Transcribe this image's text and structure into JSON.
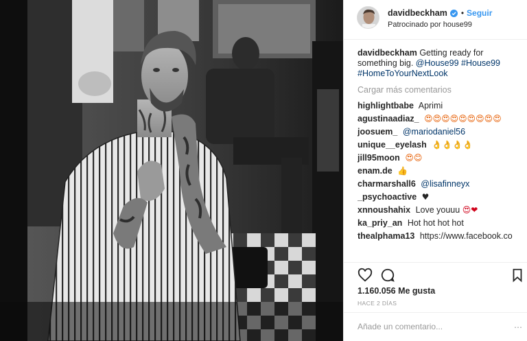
{
  "colors": {
    "link": "#003569",
    "follow": "#3897f0",
    "muted": "#999999",
    "text": "#262626",
    "heart": "#d0021b"
  },
  "header": {
    "username": "davidbeckham",
    "follow_label": "Seguir",
    "separator": "•",
    "sponsored": "Patrocinado por house99",
    "verified_icon": "verified-badge-icon"
  },
  "caption": {
    "user": "davidbeckham",
    "text": "Getting ready for something big.",
    "mentions": [
      "@House99",
      "#House99",
      "#HomeToYourNextLook"
    ]
  },
  "load_more": "Cargar más comentarios",
  "comments": [
    {
      "user": "highlightbabe",
      "text": "Aprimi"
    },
    {
      "user": "agustinaadiaz_",
      "text": "😍😍😍😍😍😍😍😍😍"
    },
    {
      "user": "joosuem_",
      "text": "@mariodaniel56"
    },
    {
      "user": "unique__eyelash",
      "text": "👌👌👌👌"
    },
    {
      "user": "jill95moon",
      "text": "😍😊"
    },
    {
      "user": "enam.de",
      "text": "👍"
    },
    {
      "user": "charmarshall6",
      "text": "@lisafinneyx"
    },
    {
      "user": "_psychoactive",
      "text": "♥"
    },
    {
      "user": "xnnoushahix",
      "text": "Love youuu",
      "emoji": "😍❤"
    },
    {
      "user": "ka_priy_an",
      "text": "Hot hot hot hot"
    },
    {
      "user": "thealphama13",
      "text": "https://www.facebook.co"
    }
  ],
  "actions": {
    "like_icon": "heart-outline-icon",
    "comment_icon": "comment-bubble-icon",
    "save_icon": "bookmark-icon"
  },
  "likes": "1.160.056 Me gusta",
  "time": "HACE 2 DÍAS",
  "add_comment": {
    "placeholder": "Añade un comentario..."
  },
  "more_icon": "more-options-icon"
}
